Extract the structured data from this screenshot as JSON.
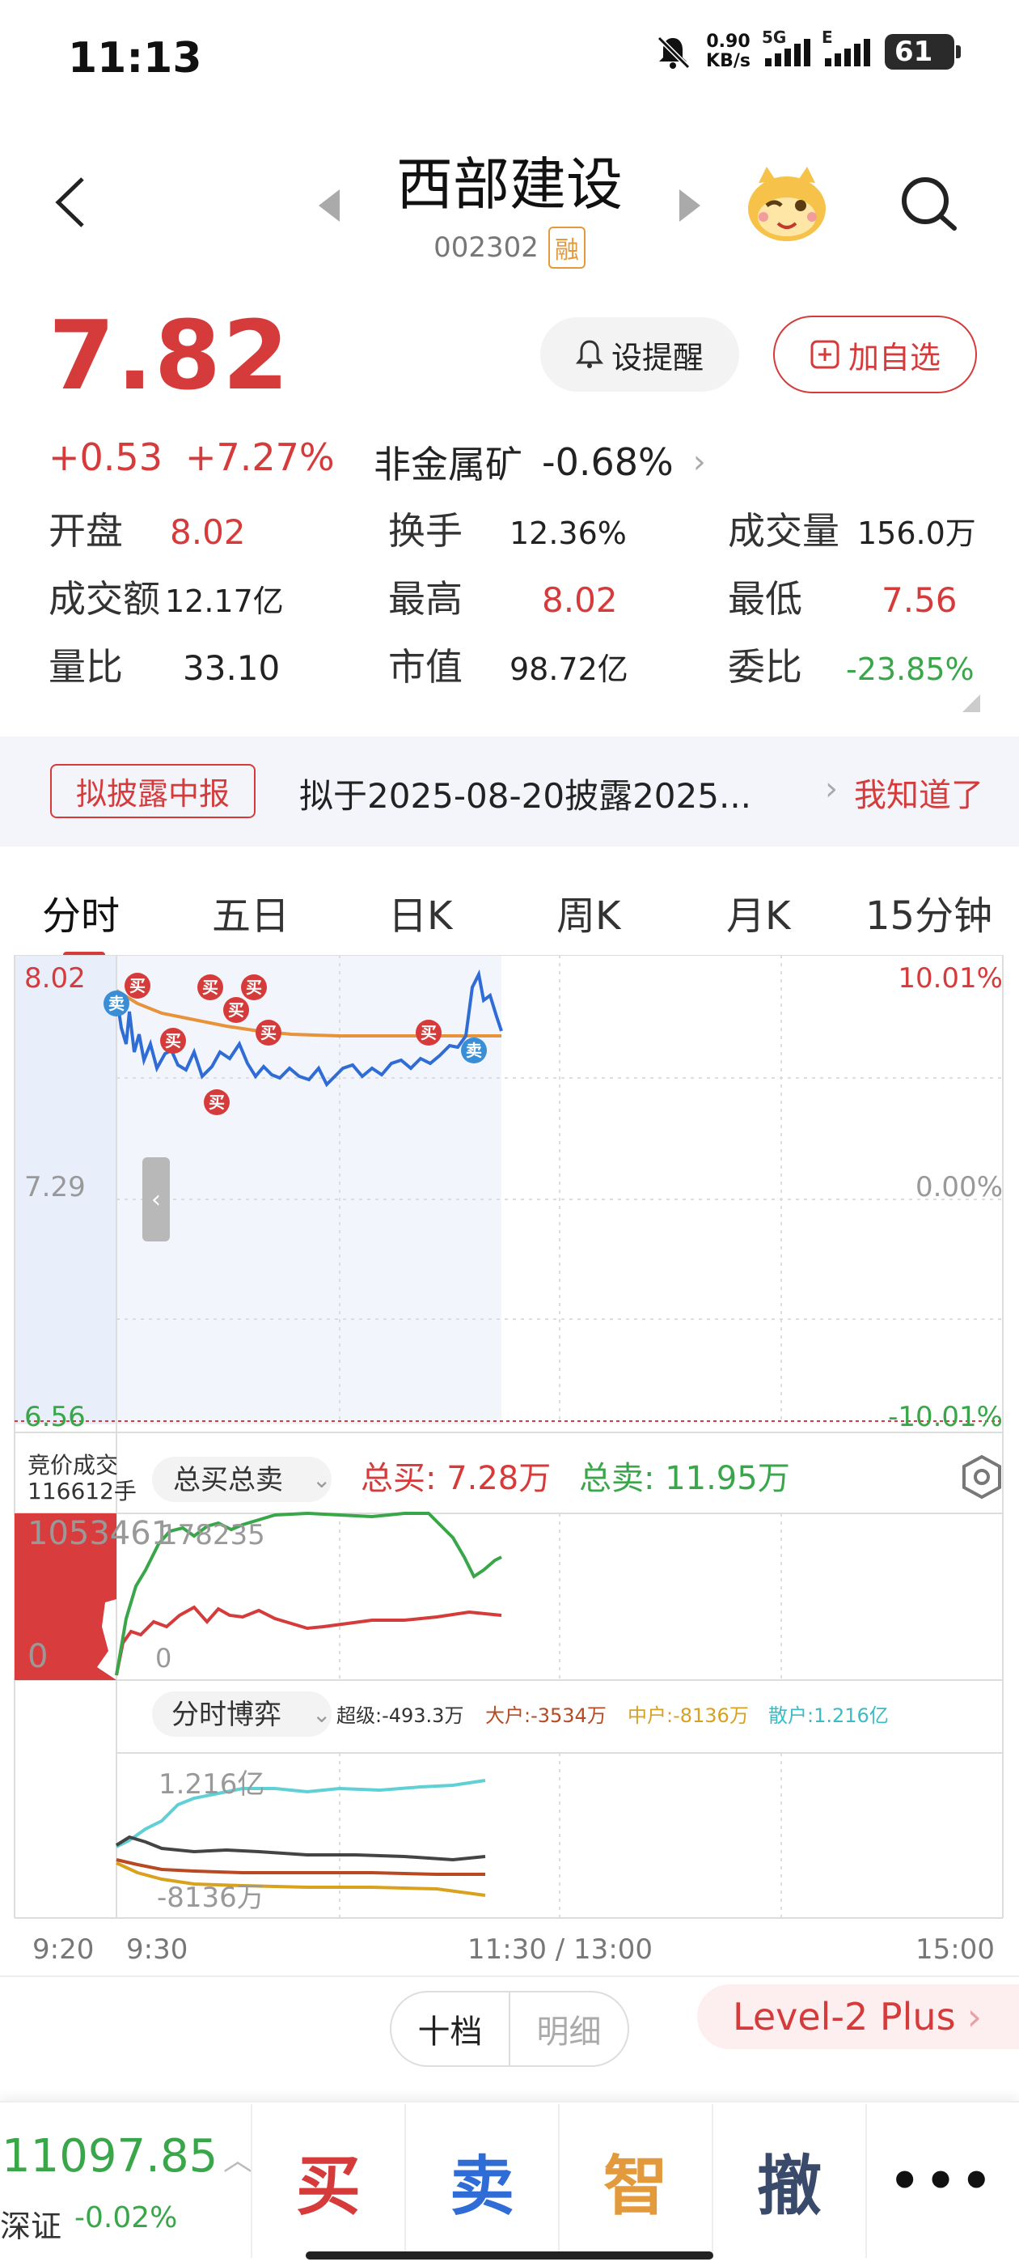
{
  "status_bar": {
    "time": "11:13",
    "net_speed": "0.90",
    "net_unit": "KB/s",
    "sim1": "5G",
    "sim2": "E",
    "battery": "61"
  },
  "header": {
    "name": "西部建设",
    "code": "002302",
    "margin_badge": "融",
    "icons": [
      "back-icon",
      "prev-stock-icon",
      "next-stock-icon",
      "mascot-icon",
      "search-icon"
    ]
  },
  "quote": {
    "price": "7.82",
    "change": "+0.53",
    "change_pct": "+7.27%",
    "sector_name": "非金属矿",
    "sector_pct": "-0.68%",
    "alert_label": "设提醒",
    "watch_label": "加自选"
  },
  "stats": [
    {
      "k": "开盘",
      "v": "8.02",
      "color": "#d63b3b"
    },
    {
      "k": "换手",
      "v": "12.36%",
      "color": "#222"
    },
    {
      "k": "成交量",
      "v": "156.0万",
      "color": "#222"
    },
    {
      "k": "成交额",
      "v": "12.17亿",
      "color": "#222"
    },
    {
      "k": "最高",
      "v": "8.02",
      "color": "#d63b3b"
    },
    {
      "k": "最低",
      "v": "7.56",
      "color": "#d63b3b"
    },
    {
      "k": "量比",
      "v": "33.10",
      "color": "#222"
    },
    {
      "k": "市值",
      "v": "98.72亿",
      "color": "#222"
    },
    {
      "k": "委比",
      "v": "-23.85%",
      "color": "#3aa64a"
    }
  ],
  "banner": {
    "tag": "拟披露中报",
    "text": "拟于2025-08-20披露2025...",
    "dismiss": "我知道了"
  },
  "tabs": [
    "分时",
    "五日",
    "日K",
    "周K",
    "月K",
    "15分钟"
  ],
  "chart": {
    "y_top": "8.02",
    "y_mid": "7.29",
    "y_bot": "6.56",
    "pct_top": "10.01%",
    "pct_mid": "0.00%",
    "pct_bot": "-10.01%",
    "auction_label": "竞价成交",
    "auction_volume": "116612手",
    "buy_sell_selector": "总买总卖",
    "total_buy": "总买: 7.28万",
    "total_sell": "总卖: 11.95万",
    "vol_max": "1053461",
    "vol_max2": "178235",
    "vol_zero": "0",
    "vol_zero2": "0",
    "game_selector": "分时博弈",
    "super": "超级:-493.3万",
    "large": "大户:-3534万",
    "mid": "中户:-8136万",
    "retail": "散户:1.216亿",
    "game_max": "1.216亿",
    "game_min": "-8136万",
    "t0": "9:20",
    "t1": "9:30",
    "t2": "11:30 / 13:00",
    "t3": "15:00",
    "marker_buy": "买",
    "marker_sell": "卖"
  },
  "orderbook": {
    "ten_label": "十档",
    "detail_label": "明细",
    "level2_label": "Level-2 Plus"
  },
  "bottom": {
    "index_value": "11097.85",
    "index_name": "深证",
    "index_change": "-0.02%",
    "buy": "买",
    "sell": "卖",
    "smart": "智",
    "cancel": "撤",
    "more": "•••"
  }
}
